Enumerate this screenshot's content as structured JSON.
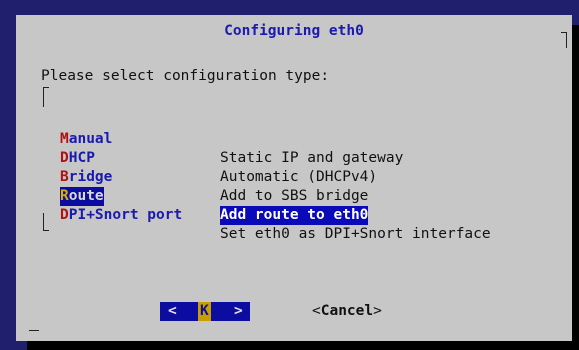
{
  "dialog": {
    "title": "Configuring eth0",
    "prompt": "Please select configuration type:"
  },
  "menu": [
    {
      "hot": "M",
      "rest": "anual",
      "desc": "Static IP and gateway",
      "selected": false
    },
    {
      "hot": "D",
      "rest": "HCP",
      "desc": "Automatic (DHCPv4)",
      "selected": false
    },
    {
      "hot": "B",
      "rest": "ridge",
      "desc": "Add to SBS bridge",
      "selected": false
    },
    {
      "hot": "R",
      "rest": "oute",
      "desc": "Add route to eth0",
      "selected": true
    },
    {
      "hot": "D",
      "rest": "PI+Snort port",
      "desc": "Set eth0 as DPI+Snort interface",
      "selected": false
    }
  ],
  "buttons": {
    "ok": {
      "left": "<",
      "hot": "K",
      "right": ">"
    },
    "cancel": {
      "open": "<",
      "label": "Cancel",
      "close": ">"
    }
  },
  "colors": {
    "background": "#1f1f6e",
    "dialog": "#c7c7c7",
    "title": "#1a1ab0",
    "hotkey": "#b01010",
    "selection": "#0a0ab8"
  }
}
